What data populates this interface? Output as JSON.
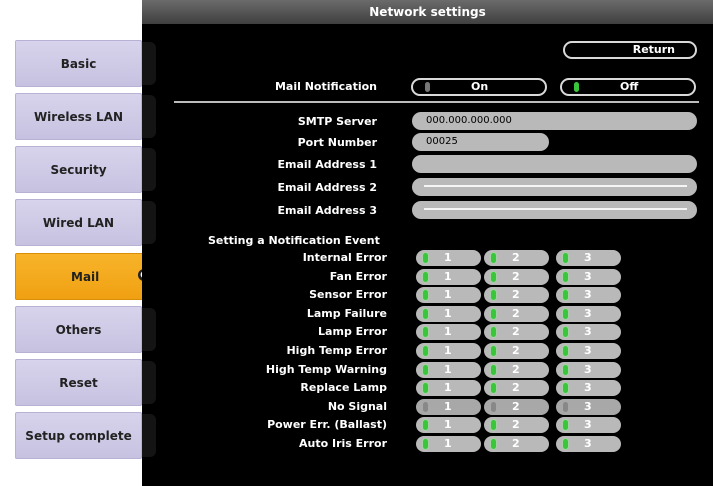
{
  "header": {
    "title": "Network settings"
  },
  "sidebar": {
    "items": [
      {
        "label": "Basic"
      },
      {
        "label": "Wireless LAN"
      },
      {
        "label": "Security"
      },
      {
        "label": "Wired LAN"
      },
      {
        "label": "Mail",
        "active": true
      },
      {
        "label": "Others"
      },
      {
        "label": "Reset"
      },
      {
        "label": "Setup complete"
      }
    ]
  },
  "return_label": "Return",
  "mail_notification": {
    "label": "Mail Notification",
    "on_label": "On",
    "off_label": "Off",
    "selected": "Off"
  },
  "fields": {
    "smtp_server": {
      "label": "SMTP Server",
      "value": "000.000.000.000"
    },
    "port_number": {
      "label": "Port Number",
      "value": "00025"
    },
    "email1": {
      "label": "Email Address 1",
      "value": ""
    },
    "email2": {
      "label": "Email Address 2",
      "value": ""
    },
    "email3": {
      "label": "Email Address 3",
      "value": ""
    }
  },
  "events_heading": "Setting a Notification Event",
  "event_options": [
    "1",
    "2",
    "3"
  ],
  "events": [
    {
      "label": "Internal Error",
      "states": [
        true,
        true,
        true
      ]
    },
    {
      "label": "Fan Error",
      "states": [
        true,
        true,
        true
      ]
    },
    {
      "label": "Sensor Error",
      "states": [
        true,
        true,
        true
      ]
    },
    {
      "label": "Lamp Failure",
      "states": [
        true,
        true,
        true
      ]
    },
    {
      "label": "Lamp Error",
      "states": [
        true,
        true,
        true
      ]
    },
    {
      "label": "High Temp Error",
      "states": [
        true,
        true,
        true
      ]
    },
    {
      "label": "High Temp Warning",
      "states": [
        true,
        true,
        true
      ]
    },
    {
      "label": "Replace Lamp",
      "states": [
        true,
        true,
        true
      ]
    },
    {
      "label": "No Signal",
      "states": [
        false,
        false,
        false
      ]
    },
    {
      "label": "Power Err. (Ballast)",
      "states": [
        true,
        true,
        true
      ]
    },
    {
      "label": "Auto Iris Error",
      "states": [
        true,
        true,
        true
      ]
    }
  ],
  "colors": {
    "accent": "#f5a91e",
    "tab": "#cfcae7",
    "led_on": "#3ac63a",
    "led_off": "#888888"
  }
}
